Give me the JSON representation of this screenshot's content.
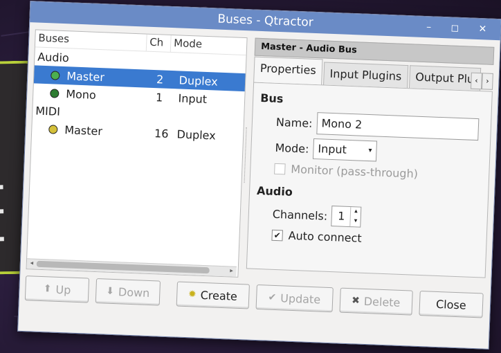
{
  "window": {
    "title": "Buses - Qtractor",
    "controls": "– ◻ ✕"
  },
  "tree": {
    "headers": {
      "buses": "Buses",
      "ch": "Ch",
      "mode": "Mode"
    },
    "audio_group": "Audio",
    "audio_rows": [
      {
        "name": "Master",
        "ch": "2",
        "mode": "Duplex",
        "selected": true,
        "icon_color": "#4caf50"
      },
      {
        "name": "Mono",
        "ch": "1",
        "mode": "Input",
        "selected": false,
        "icon_color": "#2e7d32"
      }
    ],
    "midi_group": "MIDI",
    "midi_rows": [
      {
        "name": "Master",
        "ch": "16",
        "mode": "Duplex",
        "selected": false,
        "icon_color": "#d4c03a"
      }
    ]
  },
  "panel": {
    "header": "Master - Audio Bus",
    "tabs": [
      "Properties",
      "Input Plugins",
      "Output Plu"
    ],
    "bus_label": "Bus",
    "name_label": "Name:",
    "name_value": "Mono 2",
    "mode_label": "Mode:",
    "mode_value": "Input",
    "monitor_label": "Monitor (pass-through)",
    "audio_label": "Audio",
    "channels_label": "Channels:",
    "channels_value": "1",
    "auto_connect_label": "Auto connect",
    "auto_connect_checked": true
  },
  "buttons": {
    "up": "Up",
    "down": "Down",
    "create": "Create",
    "update": "Update",
    "delete": "Delete",
    "close": "Close"
  },
  "colors": {
    "selection": "#3a7ad0",
    "titlebar": "#6a8bc6",
    "accent_panel": "#b9d13a"
  }
}
